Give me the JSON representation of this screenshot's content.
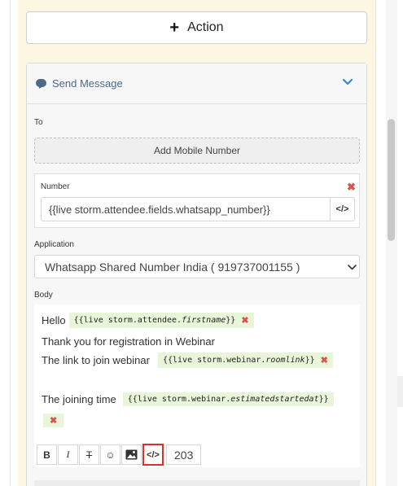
{
  "action_button": {
    "label": "Action",
    "icon": "plus-icon"
  },
  "card": {
    "title": "Send Message",
    "icon": "message-icon",
    "to_label": "To",
    "add_mobile_label": "Add Mobile Number",
    "number": {
      "label": "Number",
      "value": "{{live storm.attendee.fields.whatsapp_number}}",
      "code_button": "</>"
    },
    "application": {
      "label": "Application",
      "selected": "Whatsapp Shared Number India ( 919737001155 )"
    },
    "body": {
      "label": "Body",
      "line1_text": "Hello",
      "line1_tag_prefix": "{{live storm.attendee.",
      "line1_tag_italic": "firstname",
      "line1_tag_suffix": "}}",
      "line2_text": "Thank you for registration in  Webinar",
      "line3_text": "The link to join webinar",
      "line3_tag_prefix": "{{live storm.webinar.",
      "line3_tag_italic": "roomlink",
      "line3_tag_suffix": "}}",
      "line4_text": "The joining time",
      "line4_tag_prefix": "{{live storm.webinar.",
      "line4_tag_italic": "estimatedstartedat",
      "line4_tag_suffix": "}}",
      "remove_mark": "✖"
    },
    "toolbar": {
      "bold": "B",
      "italic": "I",
      "strike": "T",
      "emoji": "☺",
      "code": "</>",
      "char_count": "203"
    }
  },
  "colors": {
    "panel_bg": "#fdf6e3",
    "accent_blue": "#4a6a8a",
    "chevron_blue": "#3a87d6",
    "remove_red": "#d9534f",
    "tag_green": "#e8f5d8",
    "highlight_red": "#d9302a"
  }
}
